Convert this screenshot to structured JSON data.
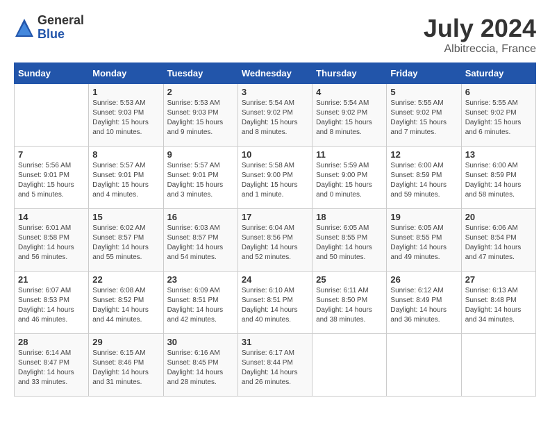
{
  "logo": {
    "general": "General",
    "blue": "Blue"
  },
  "title": {
    "month_year": "July 2024",
    "location": "Albitreccia, France"
  },
  "headers": [
    "Sunday",
    "Monday",
    "Tuesday",
    "Wednesday",
    "Thursday",
    "Friday",
    "Saturday"
  ],
  "weeks": [
    [
      {
        "day": "",
        "info": ""
      },
      {
        "day": "1",
        "info": "Sunrise: 5:53 AM\nSunset: 9:03 PM\nDaylight: 15 hours\nand 10 minutes."
      },
      {
        "day": "2",
        "info": "Sunrise: 5:53 AM\nSunset: 9:03 PM\nDaylight: 15 hours\nand 9 minutes."
      },
      {
        "day": "3",
        "info": "Sunrise: 5:54 AM\nSunset: 9:02 PM\nDaylight: 15 hours\nand 8 minutes."
      },
      {
        "day": "4",
        "info": "Sunrise: 5:54 AM\nSunset: 9:02 PM\nDaylight: 15 hours\nand 8 minutes."
      },
      {
        "day": "5",
        "info": "Sunrise: 5:55 AM\nSunset: 9:02 PM\nDaylight: 15 hours\nand 7 minutes."
      },
      {
        "day": "6",
        "info": "Sunrise: 5:55 AM\nSunset: 9:02 PM\nDaylight: 15 hours\nand 6 minutes."
      }
    ],
    [
      {
        "day": "7",
        "info": "Sunrise: 5:56 AM\nSunset: 9:01 PM\nDaylight: 15 hours\nand 5 minutes."
      },
      {
        "day": "8",
        "info": "Sunrise: 5:57 AM\nSunset: 9:01 PM\nDaylight: 15 hours\nand 4 minutes."
      },
      {
        "day": "9",
        "info": "Sunrise: 5:57 AM\nSunset: 9:01 PM\nDaylight: 15 hours\nand 3 minutes."
      },
      {
        "day": "10",
        "info": "Sunrise: 5:58 AM\nSunset: 9:00 PM\nDaylight: 15 hours\nand 1 minute."
      },
      {
        "day": "11",
        "info": "Sunrise: 5:59 AM\nSunset: 9:00 PM\nDaylight: 15 hours\nand 0 minutes."
      },
      {
        "day": "12",
        "info": "Sunrise: 6:00 AM\nSunset: 8:59 PM\nDaylight: 14 hours\nand 59 minutes."
      },
      {
        "day": "13",
        "info": "Sunrise: 6:00 AM\nSunset: 8:59 PM\nDaylight: 14 hours\nand 58 minutes."
      }
    ],
    [
      {
        "day": "14",
        "info": "Sunrise: 6:01 AM\nSunset: 8:58 PM\nDaylight: 14 hours\nand 56 minutes."
      },
      {
        "day": "15",
        "info": "Sunrise: 6:02 AM\nSunset: 8:57 PM\nDaylight: 14 hours\nand 55 minutes."
      },
      {
        "day": "16",
        "info": "Sunrise: 6:03 AM\nSunset: 8:57 PM\nDaylight: 14 hours\nand 54 minutes."
      },
      {
        "day": "17",
        "info": "Sunrise: 6:04 AM\nSunset: 8:56 PM\nDaylight: 14 hours\nand 52 minutes."
      },
      {
        "day": "18",
        "info": "Sunrise: 6:05 AM\nSunset: 8:55 PM\nDaylight: 14 hours\nand 50 minutes."
      },
      {
        "day": "19",
        "info": "Sunrise: 6:05 AM\nSunset: 8:55 PM\nDaylight: 14 hours\nand 49 minutes."
      },
      {
        "day": "20",
        "info": "Sunrise: 6:06 AM\nSunset: 8:54 PM\nDaylight: 14 hours\nand 47 minutes."
      }
    ],
    [
      {
        "day": "21",
        "info": "Sunrise: 6:07 AM\nSunset: 8:53 PM\nDaylight: 14 hours\nand 46 minutes."
      },
      {
        "day": "22",
        "info": "Sunrise: 6:08 AM\nSunset: 8:52 PM\nDaylight: 14 hours\nand 44 minutes."
      },
      {
        "day": "23",
        "info": "Sunrise: 6:09 AM\nSunset: 8:51 PM\nDaylight: 14 hours\nand 42 minutes."
      },
      {
        "day": "24",
        "info": "Sunrise: 6:10 AM\nSunset: 8:51 PM\nDaylight: 14 hours\nand 40 minutes."
      },
      {
        "day": "25",
        "info": "Sunrise: 6:11 AM\nSunset: 8:50 PM\nDaylight: 14 hours\nand 38 minutes."
      },
      {
        "day": "26",
        "info": "Sunrise: 6:12 AM\nSunset: 8:49 PM\nDaylight: 14 hours\nand 36 minutes."
      },
      {
        "day": "27",
        "info": "Sunrise: 6:13 AM\nSunset: 8:48 PM\nDaylight: 14 hours\nand 34 minutes."
      }
    ],
    [
      {
        "day": "28",
        "info": "Sunrise: 6:14 AM\nSunset: 8:47 PM\nDaylight: 14 hours\nand 33 minutes."
      },
      {
        "day": "29",
        "info": "Sunrise: 6:15 AM\nSunset: 8:46 PM\nDaylight: 14 hours\nand 31 minutes."
      },
      {
        "day": "30",
        "info": "Sunrise: 6:16 AM\nSunset: 8:45 PM\nDaylight: 14 hours\nand 28 minutes."
      },
      {
        "day": "31",
        "info": "Sunrise: 6:17 AM\nSunset: 8:44 PM\nDaylight: 14 hours\nand 26 minutes."
      },
      {
        "day": "",
        "info": ""
      },
      {
        "day": "",
        "info": ""
      },
      {
        "day": "",
        "info": ""
      }
    ]
  ]
}
